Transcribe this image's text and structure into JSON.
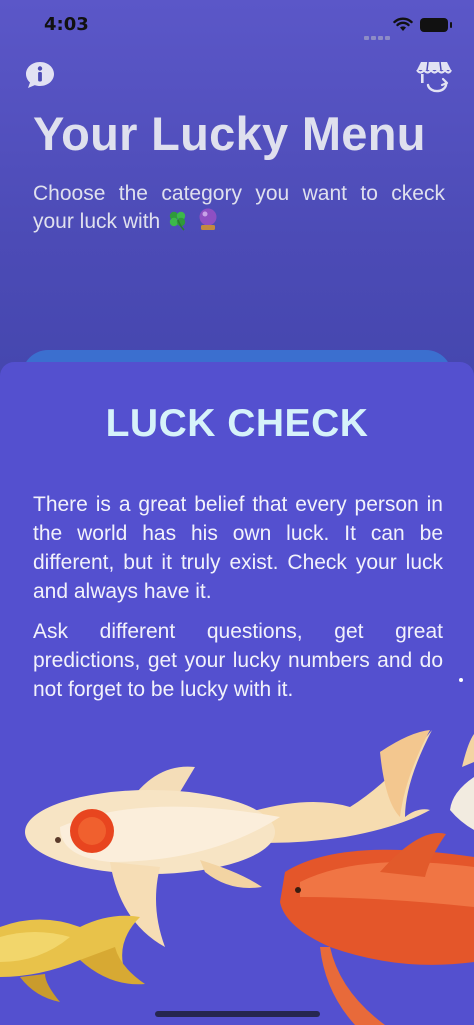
{
  "status_bar": {
    "time": "4:03"
  },
  "header": {
    "title": "Your Lucky Menu",
    "subtitle": "Choose the category you want to ckeck your luck with",
    "emojis": [
      "🍀",
      "🔮"
    ]
  },
  "icons": {
    "info": "info-bubble-icon",
    "shop": "shop-store-icon"
  },
  "sheet": {
    "title": "LUCK CHECK",
    "paragraphs": [
      "There is a great belief that every person in the world has his own luck. It can be different, but it truly exist. Check your luck and always have it.",
      "Ask different questions, get great predictions, get your lucky numbers and do not forget to be lucky with it."
    ]
  },
  "colors": {
    "background": "#4b47b4",
    "sheet": "#5450cf",
    "sheet_title": "#d6f2fa",
    "header_text": "#dfe0ee"
  }
}
